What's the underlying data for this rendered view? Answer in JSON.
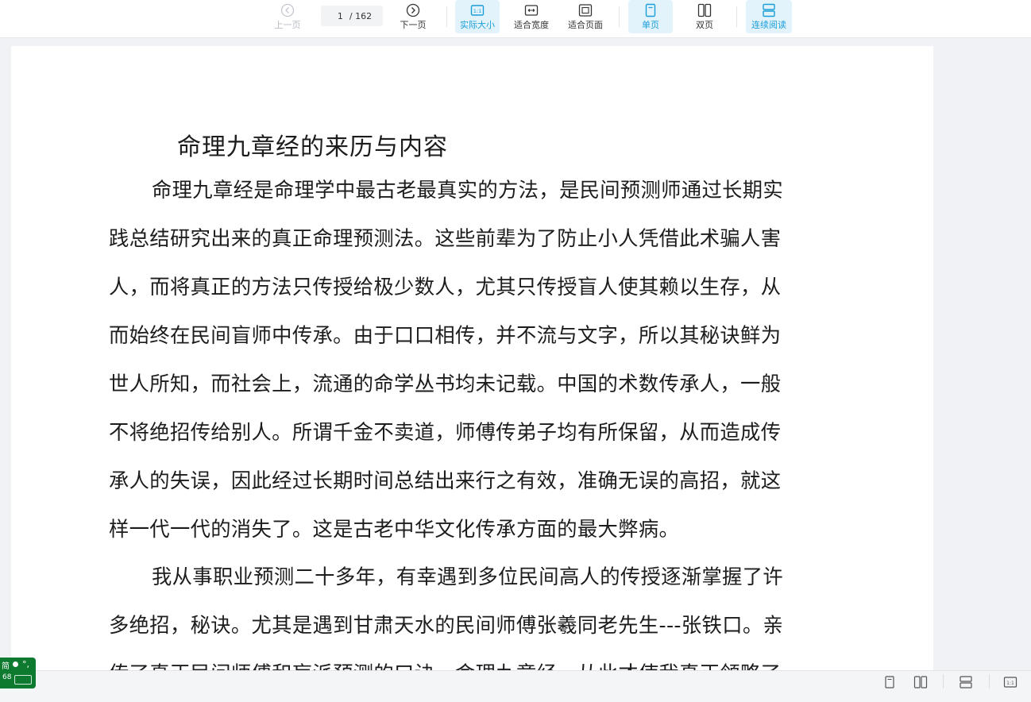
{
  "toolbar": {
    "prev_page_label": "上一页",
    "current_page": "1",
    "total_pages": "/ 162",
    "next_page_label": "下一页",
    "actual_size_label": "实际大小",
    "fit_width_label": "适合宽度",
    "fit_page_label": "适合页面",
    "single_page_label": "单页",
    "double_page_label": "双页",
    "continuous_label": "连续阅读",
    "actual_size_icon_text": "1:1"
  },
  "document": {
    "title": "命理九章经的来历与内容",
    "paragraph1_lines": [
      "命理九章经是命理学中最古老最真实的方法，是民间预测师通过长期实",
      "践总结研究出来的真正命理预测法。这些前辈为了防止小人凭借此术骗人害",
      "人，而将真正的方法只传授给极少数人，尤其只传授盲人使其赖以生存，从",
      "而始终在民间盲师中传承。由于口口相传，并不流与文字，所以其秘诀鲜为",
      "世人所知，而社会上，流通的命学丛书均未记载。中国的术数传承人，一般",
      "不将绝招传给别人。所谓千金不卖道，师傅传弟子均有所保留，从而造成传",
      "承人的失误，因此经过长期时间总结出来行之有效，准确无误的高招，就这",
      "样一代一代的消失了。这是古老中华文化传承方面的最大弊病。"
    ],
    "paragraph2_lines": [
      "我从事职业预测二十多年，有幸遇到多位民间高人的传授逐渐掌握了许",
      "多绝招，秘诀。尤其是遇到甘肃天水的民间师傅张羲同老先生---张铁口。亲",
      "传了真正民间师傅和盲派预测的口诀，命理九章经。从此才使我真正领略了"
    ]
  },
  "statusbar": {
    "actual_size_icon_text": "1:1"
  },
  "ime": {
    "mode_char": "简",
    "punct": "°,",
    "number": "68"
  },
  "colors": {
    "accent": "#1a9ed8",
    "active_bg": "#e3f3fc",
    "ime_green": "#0d7a2f"
  }
}
